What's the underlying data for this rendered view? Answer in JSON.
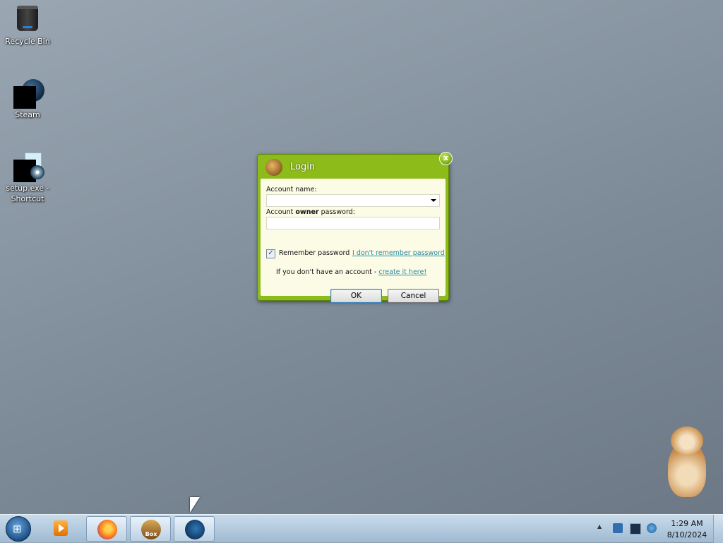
{
  "desktop": {
    "icons": [
      {
        "label": "Recycle Bin"
      },
      {
        "label": "Steam"
      },
      {
        "label": "setup.exe - Shortcut"
      }
    ]
  },
  "login_dialog": {
    "title": "Login",
    "close_glyph": "x",
    "account_name_label": "Account name:",
    "account_name_value": "",
    "password_label_pre": "Account ",
    "password_label_bold": "owner",
    "password_label_post": " password:",
    "password_value": "",
    "remember_label": "Remember password",
    "remember_checked": true,
    "forgot_link": "I don't remember password",
    "no_account_text": "If you don't have an account - ",
    "create_link": "create it here!",
    "ok_label": "OK",
    "cancel_label": "Cancel",
    "accent_color": "#8dbb1a"
  },
  "taskbar": {
    "start_glyph": "⊞",
    "pinned": [
      {
        "name": "windows-media-player",
        "icon": "media-player-icon"
      },
      {
        "name": "firefox",
        "icon": "firefox-icon"
      },
      {
        "name": "box",
        "icon": "box-icon",
        "label": "Box"
      },
      {
        "name": "steam",
        "icon": "steam-icon"
      }
    ],
    "tray": {
      "show_hidden_glyph": "▲",
      "time": "1:29 AM",
      "date": "8/10/2024"
    }
  }
}
